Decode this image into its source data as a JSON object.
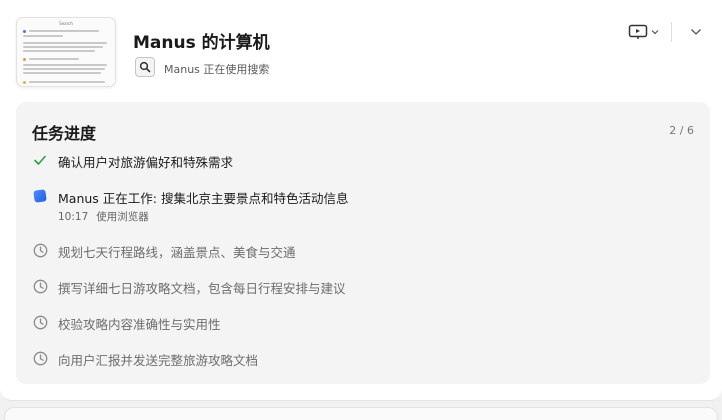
{
  "header": {
    "title": "Manus 的计算机",
    "tool_icon": "search-icon",
    "status_text": "Manus 正在使用搜索",
    "thumbnail": {
      "title": "Search"
    },
    "screen_icon": "display-icon",
    "collapse_icon": "chevron-down-icon"
  },
  "progress": {
    "title": "任务进度",
    "counter": "2 / 6",
    "steps": [
      {
        "label": "确认用户对旅游偏好和特殊需求",
        "state": "done"
      },
      {
        "label": "Manus 正在工作: 搜集北京主要景点和特色活动信息",
        "state": "active",
        "time": "10:17",
        "tool": "使用浏览器"
      },
      {
        "label": "规划七天行程路线，涵盖景点、美食与交通",
        "state": "pending"
      },
      {
        "label": "撰写详细七日游攻略文档，包含每日行程安排与建议",
        "state": "pending"
      },
      {
        "label": "校验攻略内容准确性与实用性",
        "state": "pending"
      },
      {
        "label": "向用户汇报并发送完整旅游攻略文档",
        "state": "pending"
      }
    ]
  },
  "colors": {
    "done_check": "#2e9e4f",
    "active_icon": "#2f6bf0",
    "pending_icon": "#8a8a8a",
    "panel_bg": "#f4f4f4"
  }
}
